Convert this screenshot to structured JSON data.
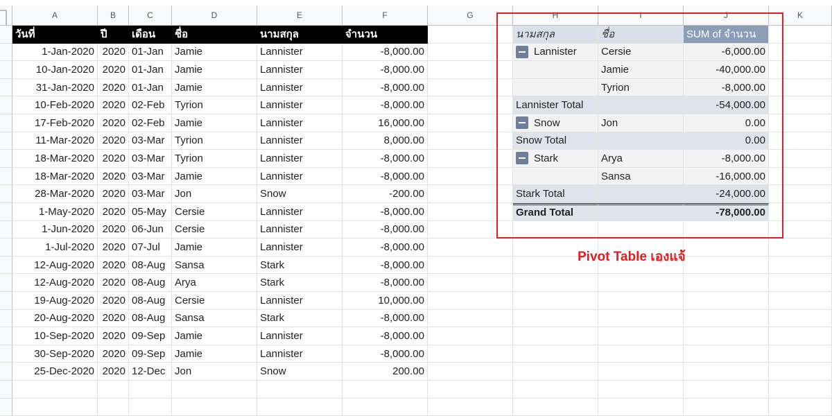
{
  "columns": [
    "A",
    "B",
    "C",
    "D",
    "E",
    "F",
    "G",
    "H",
    "I",
    "J",
    "K"
  ],
  "table": {
    "headers": [
      "วันที่",
      "ปี",
      "เดือน",
      "ชื่อ",
      "นามสกุล",
      "จำนวน"
    ],
    "rows": [
      [
        "1-Jan-2020",
        "2020",
        "01-Jan",
        "Jamie",
        "Lannister",
        "-8,000.00"
      ],
      [
        "10-Jan-2020",
        "2020",
        "01-Jan",
        "Jamie",
        "Lannister",
        "-8,000.00"
      ],
      [
        "31-Jan-2020",
        "2020",
        "01-Jan",
        "Jamie",
        "Lannister",
        "-8,000.00"
      ],
      [
        "10-Feb-2020",
        "2020",
        "02-Feb",
        "Tyrion",
        "Lannister",
        "-8,000.00"
      ],
      [
        "17-Feb-2020",
        "2020",
        "02-Feb",
        "Jamie",
        "Lannister",
        "16,000.00"
      ],
      [
        "11-Mar-2020",
        "2020",
        "03-Mar",
        "Tyrion",
        "Lannister",
        "8,000.00"
      ],
      [
        "18-Mar-2020",
        "2020",
        "03-Mar",
        "Tyrion",
        "Lannister",
        "-8,000.00"
      ],
      [
        "18-Mar-2020",
        "2020",
        "03-Mar",
        "Jamie",
        "Lannister",
        "-8,000.00"
      ],
      [
        "28-Mar-2020",
        "2020",
        "03-Mar",
        "Jon",
        "Snow",
        "-200.00"
      ],
      [
        "1-May-2020",
        "2020",
        "05-May",
        "Cersie",
        "Lannister",
        "-8,000.00"
      ],
      [
        "1-Jun-2020",
        "2020",
        "06-Jun",
        "Cersie",
        "Lannister",
        "-8,000.00"
      ],
      [
        "1-Jul-2020",
        "2020",
        "07-Jul",
        "Jamie",
        "Lannister",
        "-8,000.00"
      ],
      [
        "12-Aug-2020",
        "2020",
        "08-Aug",
        "Sansa",
        "Stark",
        "-8,000.00"
      ],
      [
        "12-Aug-2020",
        "2020",
        "08-Aug",
        "Arya",
        "Stark",
        "-8,000.00"
      ],
      [
        "19-Aug-2020",
        "2020",
        "08-Aug",
        "Cersie",
        "Lannister",
        "10,000.00"
      ],
      [
        "20-Aug-2020",
        "2020",
        "08-Aug",
        "Sansa",
        "Stark",
        "-8,000.00"
      ],
      [
        "10-Sep-2020",
        "2020",
        "09-Sep",
        "Jamie",
        "Lannister",
        "-8,000.00"
      ],
      [
        "30-Sep-2020",
        "2020",
        "09-Sep",
        "Jamie",
        "Lannister",
        "-8,000.00"
      ],
      [
        "25-Dec-2020",
        "2020",
        "12-Dec",
        "Jon",
        "Snow",
        "200.00"
      ]
    ]
  },
  "pivot": {
    "headers": [
      "นามสกุล",
      "ชื่อ",
      "SUM of จำนวน"
    ],
    "rows": [
      {
        "type": "group",
        "collapse": true,
        "h": "Lannister",
        "i": "Cersie",
        "j": "-6,000.00"
      },
      {
        "type": "item",
        "h": "",
        "i": "Jamie",
        "j": "-40,000.00"
      },
      {
        "type": "item",
        "h": "",
        "i": "Tyrion",
        "j": "-8,000.00"
      },
      {
        "type": "total",
        "h": "Lannister Total",
        "i": "",
        "j": "-54,000.00"
      },
      {
        "type": "group",
        "collapse": true,
        "h": "Snow",
        "i": "Jon",
        "j": "0.00"
      },
      {
        "type": "total",
        "h": "Snow Total",
        "i": "",
        "j": "0.00"
      },
      {
        "type": "group",
        "collapse": true,
        "h": "Stark",
        "i": "Arya",
        "j": "-8,000.00"
      },
      {
        "type": "item",
        "h": "",
        "i": "Sansa",
        "j": "-16,000.00"
      },
      {
        "type": "total",
        "h": "Stark Total",
        "i": "",
        "j": "-24,000.00"
      },
      {
        "type": "grand",
        "h": "Grand Total",
        "i": "",
        "j": "-78,000.00"
      }
    ]
  },
  "annotation": {
    "caption": "Pivot Table เองแจ้"
  }
}
